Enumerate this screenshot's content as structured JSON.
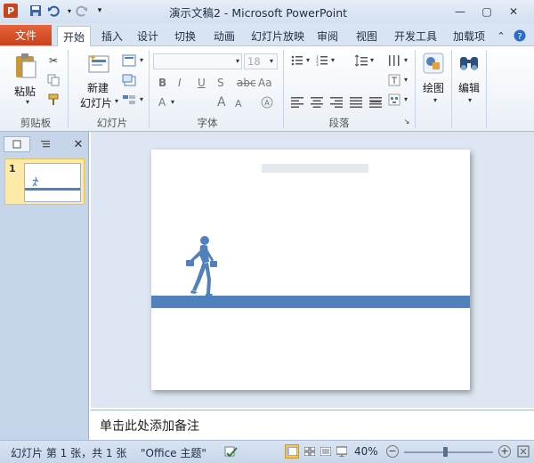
{
  "window": {
    "title": "演示文稿2 - Microsoft PowerPoint",
    "app_icon": "P"
  },
  "quick_access": {
    "save_icon": "save-icon",
    "undo_icon": "undo-icon",
    "redo_icon": "redo-icon"
  },
  "window_controls": {
    "minimize": "—",
    "maximize": "▢",
    "close": "✕"
  },
  "tabs": [
    "文件",
    "开始",
    "插入",
    "设计",
    "切换",
    "动画",
    "幻灯片放映",
    "审阅",
    "视图",
    "开发工具",
    "加载项"
  ],
  "ribbon": {
    "clipboard": {
      "paste": "粘贴",
      "group": "剪贴板"
    },
    "slides": {
      "new_slide_1": "新建",
      "new_slide_2": "幻灯片",
      "group": "幻灯片"
    },
    "font": {
      "size": "18",
      "group": "字体",
      "bold": "B",
      "italic": "I",
      "underline": "U",
      "strike": "S",
      "font_color": "A",
      "grow": "A",
      "shrink": "A",
      "case": "Aa"
    },
    "paragraph": {
      "group": "段落"
    },
    "drawing": {
      "label": "绘图"
    },
    "editing": {
      "label": "编辑"
    }
  },
  "left_panel": {
    "thumb_number": "1"
  },
  "notes": {
    "placeholder": "单击此处添加备注"
  },
  "status": {
    "slide": "幻灯片 第 1 张，共 1 张",
    "theme": "\"Office 主题\"",
    "zoom": "40%"
  }
}
